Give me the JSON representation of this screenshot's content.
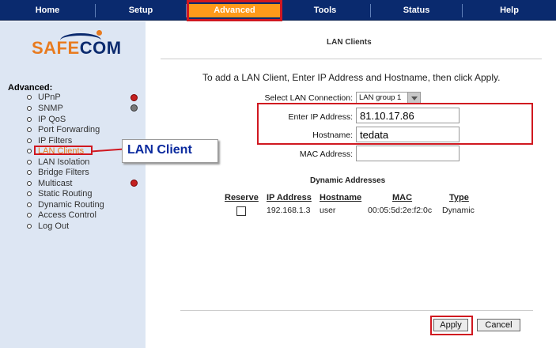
{
  "nav": {
    "items": [
      "Home",
      "Setup",
      "Advanced",
      "Tools",
      "Status",
      "Help"
    ],
    "active": "Advanced",
    "colors": {
      "bar": "#0a2a6e",
      "active": "#ff9a1a",
      "highlight": "#d01820"
    }
  },
  "sidebar": {
    "logo_part1": "SAFE",
    "logo_part2": "COM",
    "section_title": "Advanced:",
    "items": [
      {
        "label": "UPnP",
        "status": "red"
      },
      {
        "label": "SNMP",
        "status": "gray"
      },
      {
        "label": "IP QoS"
      },
      {
        "label": "Port Forwarding"
      },
      {
        "label": "IP Filters"
      },
      {
        "label": "LAN Clients",
        "selected": true
      },
      {
        "label": "LAN Isolation"
      },
      {
        "label": "Bridge Filters"
      },
      {
        "label": "Multicast",
        "status": "red"
      },
      {
        "label": "Static Routing"
      },
      {
        "label": "Dynamic Routing"
      },
      {
        "label": "Access Control"
      },
      {
        "label": "Log Out"
      }
    ]
  },
  "callout": {
    "text": "LAN Client"
  },
  "main": {
    "title": "LAN Clients",
    "instructions": "To add a LAN Client, Enter IP Address and Hostname, then click Apply.",
    "select_label": "Select LAN Connection:",
    "select_value": "LAN group 1",
    "ip_label": "Enter IP Address:",
    "ip_value": "81.10.17.86",
    "hostname_label": "Hostname:",
    "hostname_value": "tedata",
    "mac_label": "MAC Address:",
    "mac_value": ""
  },
  "dynamic": {
    "title": "Dynamic Addresses",
    "headers": [
      "Reserve",
      "IP Address",
      "Hostname",
      "MAC",
      "Type"
    ],
    "rows": [
      {
        "ip": "192.168.1.3",
        "hostname": "user",
        "mac": "00:05:5d:2e:f2:0c",
        "type": "Dynamic"
      }
    ]
  },
  "buttons": {
    "apply": "Apply",
    "cancel": "Cancel"
  }
}
